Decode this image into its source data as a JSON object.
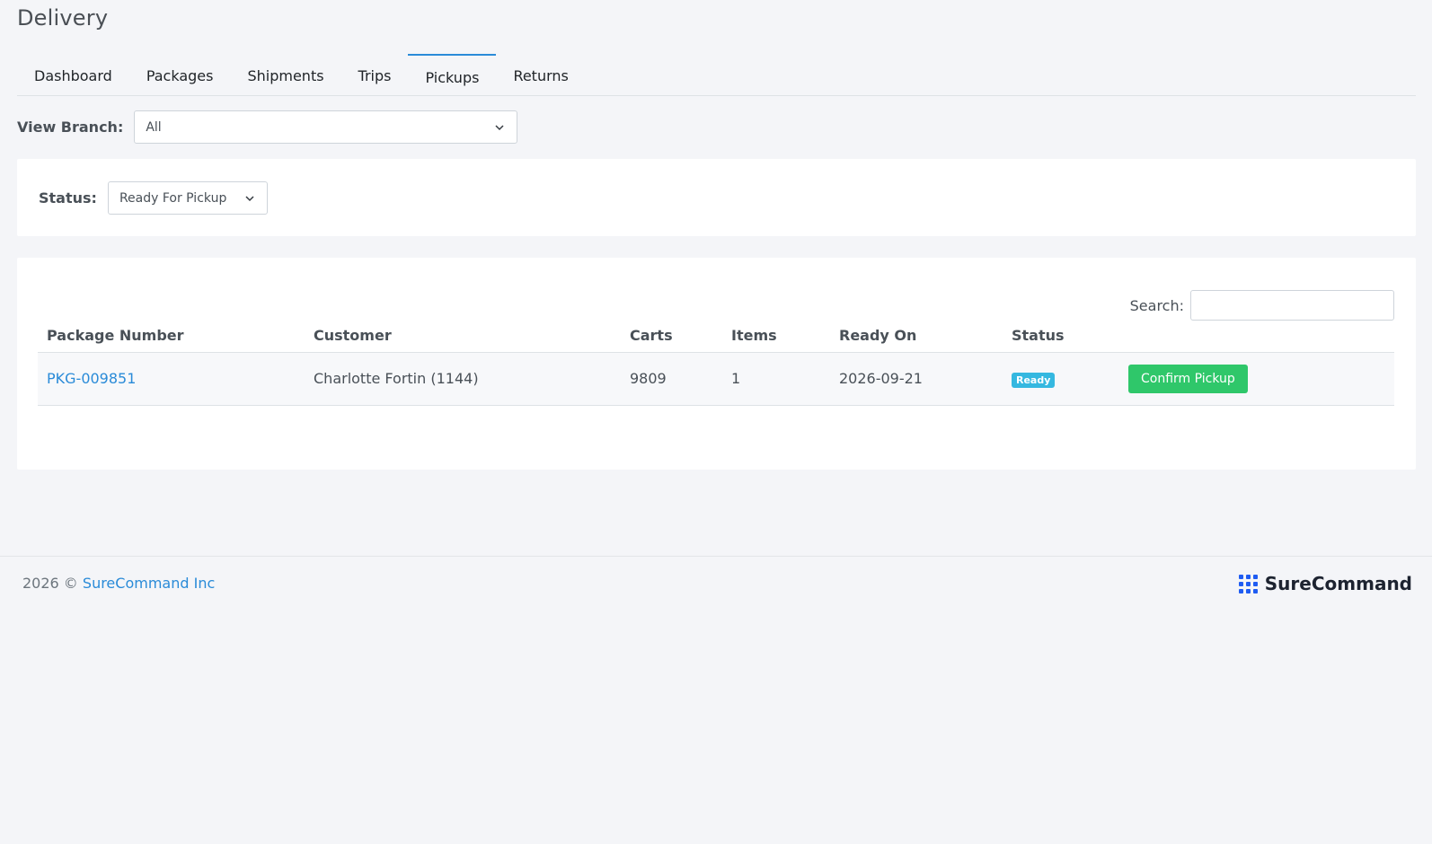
{
  "app": {
    "title": "Delivery"
  },
  "tabs": [
    {
      "label": "Dashboard",
      "active": false
    },
    {
      "label": "Packages",
      "active": false
    },
    {
      "label": "Shipments",
      "active": false
    },
    {
      "label": "Trips",
      "active": false
    },
    {
      "label": "Pickups",
      "active": true
    },
    {
      "label": "Returns",
      "active": false
    }
  ],
  "filters": {
    "branch_label": "View Branch:",
    "branch_value": "All",
    "status_label": "Status:",
    "status_value": "Ready For Pickup"
  },
  "search": {
    "label": "Search:",
    "value": ""
  },
  "table": {
    "columns": [
      "Package Number",
      "Customer",
      "Carts",
      "Items",
      "Ready On",
      "Status",
      ""
    ],
    "rows": [
      {
        "package_number": "PKG-009851",
        "customer": "Charlotte Fortin (1144)",
        "carts": "9809",
        "items": "1",
        "ready_on": "2026-09-21",
        "status": "Ready",
        "action": "Confirm Pickup"
      }
    ]
  },
  "footer": {
    "year": "2026 ©",
    "company": "SureCommand Inc",
    "brand": "SureCommand"
  },
  "colors": {
    "accent": "#2a8bd8",
    "badge_ready": "#35b8e0",
    "confirm_button": "#2fc76a",
    "brand_blue": "#1f5cf2"
  },
  "icons": {
    "select_arrow": "chevron-down-icon",
    "brand_logo": "grid-dots-icon"
  }
}
